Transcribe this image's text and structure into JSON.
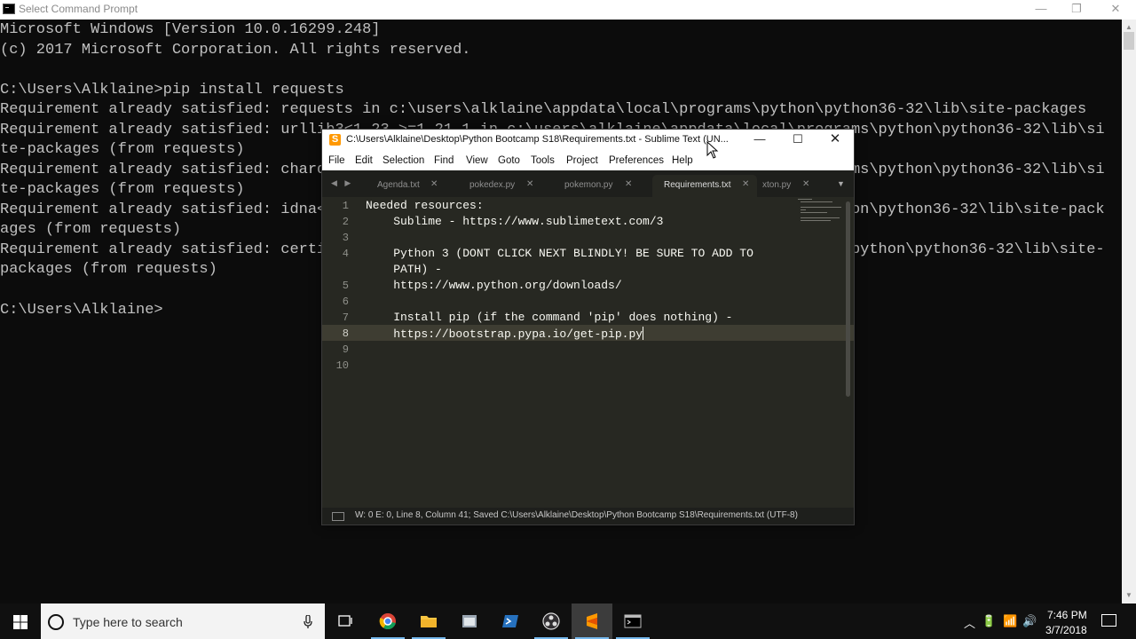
{
  "cmd": {
    "title": "Select Command Prompt",
    "controls": {
      "minimize": "—",
      "maximize": "❐",
      "close": "✕"
    },
    "lines": [
      "Microsoft Windows [Version 10.0.16299.248]",
      "(c) 2017 Microsoft Corporation. All rights reserved.",
      "",
      "C:\\Users\\Alklaine>pip install requests",
      "Requirement already satisfied: requests in c:\\users\\alklaine\\appdata\\local\\programs\\python\\python36-32\\lib\\site-packages",
      "Requirement already satisfied: urllib3<1.23,>=1.21.1 in c:\\users\\alklaine\\appdata\\local\\programs\\python\\python36-32\\lib\\si",
      "te-packages (from requests)",
      "Requirement already satisfied: chardet<3.1.0,>=3.0.2 in c:\\users\\alklaine\\appdata\\local\\programs\\python\\python36-32\\lib\\si",
      "te-packages (from requests)",
      "Requirement already satisfied: idna<2.7,>=2.5 in c:\\users\\alklaine\\appdata\\local\\programs\\python\\python36-32\\lib\\site-pack",
      "ages (from requests)",
      "Requirement already satisfied: certifi>=2017.4.17 in c:\\users\\alklaine\\appdata\\local\\programs\\python\\python36-32\\lib\\site-",
      "packages (from requests)",
      ""
    ],
    "prompt": "C:\\Users\\Alklaine>"
  },
  "sublime": {
    "title": "C:\\Users\\Alklaine\\Desktop\\Python Bootcamp S18\\Requirements.txt - Sublime Text (UN...",
    "controls": {
      "minimize": "—",
      "maximize": "☐",
      "close": "✕"
    },
    "menu": [
      "File",
      "Edit",
      "Selection",
      "Find",
      "View",
      "Goto",
      "Tools",
      "Project",
      "Preferences",
      "Help"
    ],
    "tab_nav": "◀ ▶",
    "tabs": [
      {
        "label": "Agenda.txt",
        "close": "✕"
      },
      {
        "label": "pokedex.py",
        "close": "✕"
      },
      {
        "label": "pokemon.py",
        "close": "✕"
      },
      {
        "label": "Requirements.txt",
        "close": "✕"
      },
      {
        "label": "xton.py",
        "close": "✕"
      }
    ],
    "tab_overflow": "▼",
    "line_numbers": [
      "1",
      "2",
      "3",
      "4",
      "",
      "5",
      "6",
      "7",
      "8",
      "9",
      "10"
    ],
    "code_lines": [
      "Needed resources:",
      "    Sublime - https://www.sublimetext.com/3",
      "",
      "    Python 3 (DONT CLICK NEXT BLINDLY! BE SURE TO ADD TO",
      "    PATH) -",
      "    https://www.python.org/downloads/",
      "",
      "    Install pip (if the command 'pip' does nothing) -",
      "    https://bootstrap.pypa.io/get-pip.py",
      "",
      ""
    ],
    "status": "W: 0 E: 0, Line 8, Column 41; Saved C:\\Users\\Alklaine\\Desktop\\Python Bootcamp S18\\Requirements.txt (UTF-8)"
  },
  "taskbar": {
    "search_placeholder": "Type here to search",
    "apps": [
      "task-view",
      "chrome",
      "file-explorer",
      "app-4",
      "powershell",
      "obs",
      "sublime-text",
      "command-prompt"
    ],
    "time": "7:46 PM",
    "date": "3/7/2018"
  },
  "colors": {
    "cmd_bg": "#0c0c0c",
    "cmd_text": "#c0c0c0",
    "sublime_bg": "#272822",
    "sublime_chrome": "#1e1f1c",
    "taskbar_bg": "#101010",
    "accent": "#76b9ed"
  }
}
